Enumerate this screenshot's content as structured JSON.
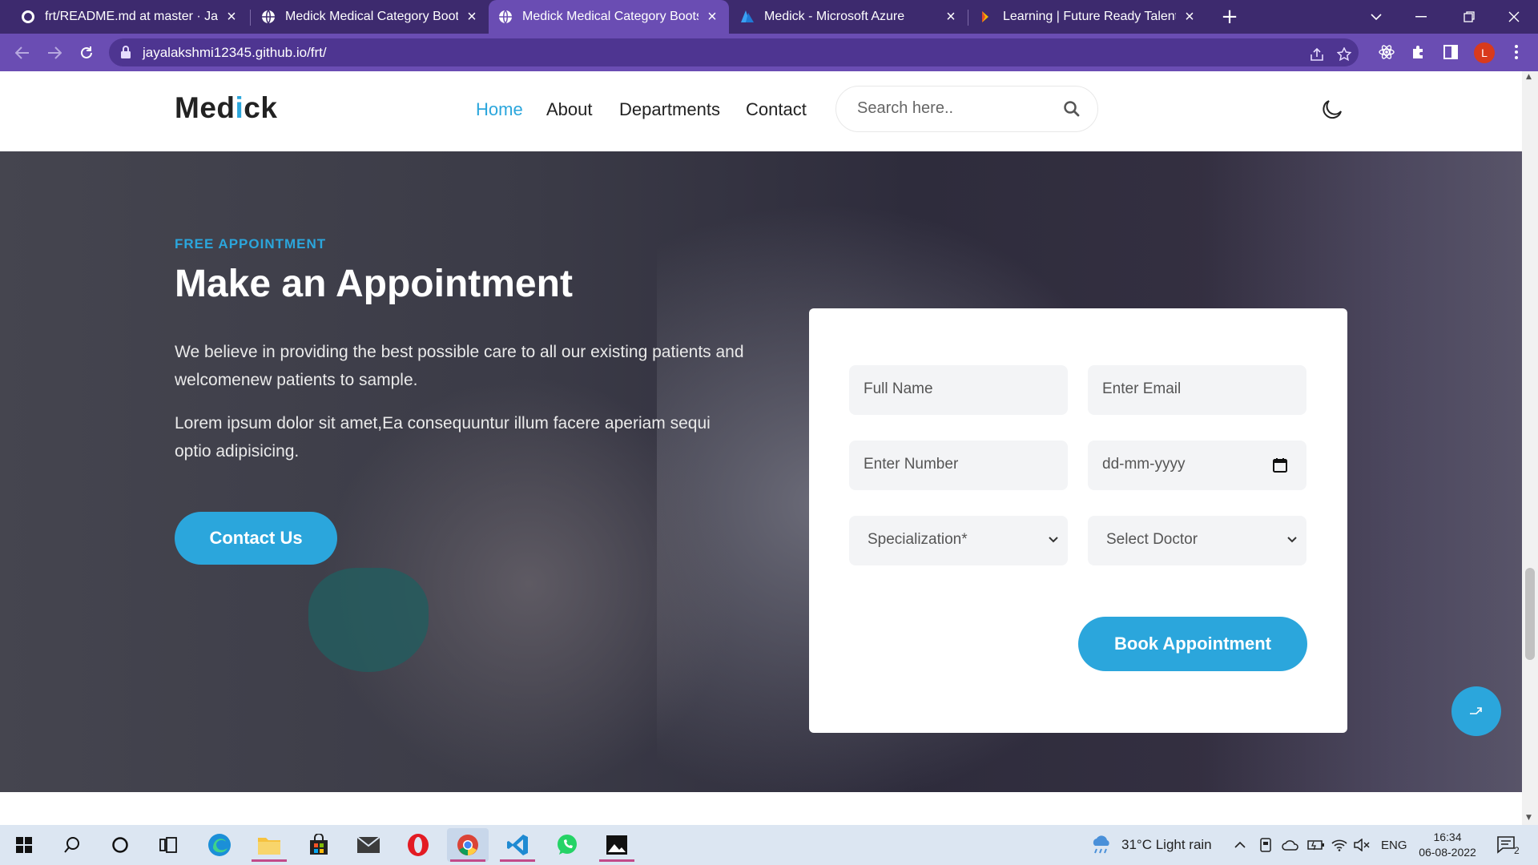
{
  "browser": {
    "tabs": [
      {
        "title": "frt/README.md at master · Jayala",
        "icon": "github-icon"
      },
      {
        "title": "Medick Medical Category Bootstr",
        "icon": "globe-icon"
      },
      {
        "title": "Medick Medical Category Bootstr",
        "icon": "globe-icon",
        "active": true
      },
      {
        "title": "Medick - Microsoft Azure",
        "icon": "azure-icon"
      },
      {
        "title": "Learning | Future Ready Talent",
        "icon": "learning-icon"
      }
    ],
    "url": "jayalakshmi12345.github.io/frt/",
    "profile_initial": "L"
  },
  "site": {
    "logo_prefix": "Med",
    "logo_i": "i",
    "logo_suffix": "ck",
    "nav": [
      "Home",
      "About",
      "Departments",
      "Contact"
    ],
    "search_placeholder": "Search here.."
  },
  "hero": {
    "eyebrow": "FREE APPOINTMENT",
    "title": "Make an Appointment",
    "para1": "We believe in providing the best possible care to all our existing patients and welcomenew patients to sample.",
    "para2": "Lorem ipsum dolor sit amet,Ea consequuntur illum facere aperiam sequi optio adipisicing.",
    "cta": "Contact Us"
  },
  "form": {
    "full_name": "Full Name",
    "email": "Enter Email",
    "number": "Enter Number",
    "date": "dd-mm-yyyy",
    "specialization": "Specialization*",
    "doctor": "Select Doctor",
    "submit": "Book Appointment"
  },
  "taskbar": {
    "weather": "31°C  Light rain",
    "lang": "ENG",
    "time": "16:34",
    "date": "06-08-2022",
    "notifications": "2"
  },
  "colors": {
    "accent": "#2ba6dc",
    "tabbar": "#3d2a6e",
    "addressbar": "#6a4db3"
  }
}
